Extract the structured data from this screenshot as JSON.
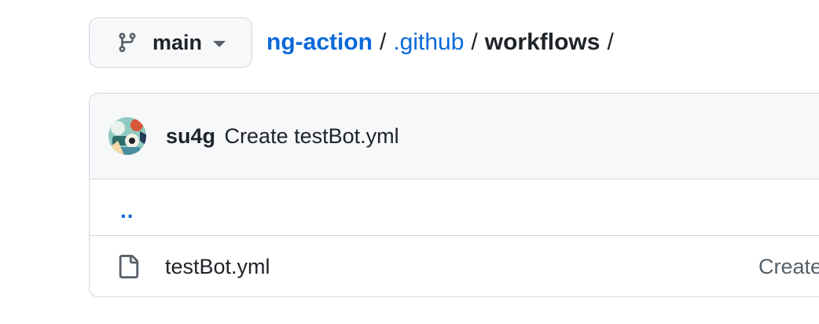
{
  "branch": {
    "icon": "git-branch-icon",
    "name": "main"
  },
  "breadcrumb": {
    "repo": "ng-action",
    "folder1": ".github",
    "current": "workflows",
    "separator": "/"
  },
  "commit": {
    "author": "su4g",
    "message": "Create testBot.yml"
  },
  "parent_link": "..",
  "files": [
    {
      "icon": "file-icon",
      "name": "testBot.yml",
      "last_commit": "Create testBot.yml"
    }
  ],
  "colors": {
    "link": "#0969da",
    "text": "#1f2328",
    "muted": "#57606a",
    "border": "#d0d7de",
    "header_bg": "#f6f8fa"
  }
}
